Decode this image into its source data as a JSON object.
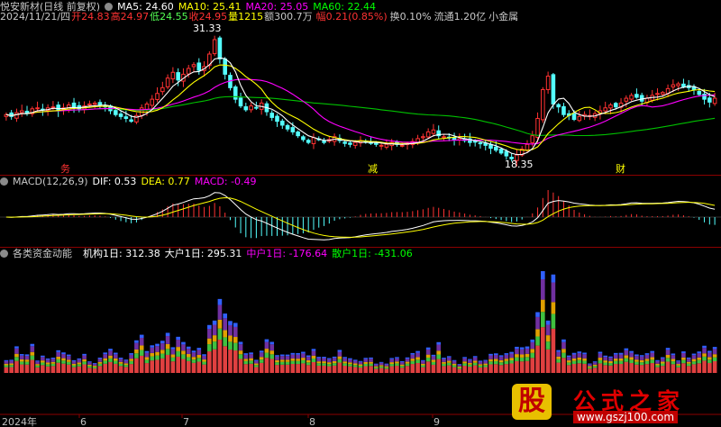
{
  "header": {
    "security": "悦安新材(日线 前复权)",
    "ma": [
      "MA5: 24.60",
      "MA10: 25.41",
      "MA20: 25.05",
      "MA60: 22.44"
    ],
    "date": "2024/11/21/四",
    "open": "开24.83",
    "high": "高24.97",
    "low": "低24.55",
    "close": "收24.95",
    "volume": "量1215",
    "amount": "额300.7万",
    "change": "幅0.21(0.85%)",
    "turnover": "换0.10%",
    "float_cap": "流通1.20亿",
    "tag": "小金属"
  },
  "macd": {
    "label": "MACD(12,26,9)",
    "dif": "DIF: 0.53",
    "dea": "DEA: 0.77",
    "macd": "MACD: -0.49"
  },
  "flow": {
    "label": "各类资金动能",
    "jigou": "机构1日: 312.38",
    "dahu": "大户1日: 295.31",
    "zhonghu": "中户1日: -176.64",
    "sanhu": "散户1日: -431.06"
  },
  "price_labels": {
    "high": "31.33",
    "low": "18.35"
  },
  "event_marks": [
    "务",
    "减",
    "财"
  ],
  "x_axis": {
    "year": "2024年",
    "months": [
      "6",
      "7",
      "8",
      "9"
    ]
  },
  "colors": {
    "up": "#ff3232",
    "down": "#54ffff",
    "ma5": "#ffffff",
    "ma10": "#ffff00",
    "ma20": "#ff00ff",
    "ma60": "#00c000",
    "flow_jigou": "#7030a0",
    "flow_dahu": "#e04040",
    "flow_zhonghu": "#40c040",
    "flow_sanhu": "#e0a000"
  },
  "watermark": {
    "big": "股",
    "title": "公式之家",
    "url": "www.gszj100.com"
  },
  "chart_data": [
    {
      "type": "candlestick",
      "title": "悦安新材(日线 前复权)",
      "ylim": [
        17.5,
        32.5
      ],
      "series_close": [
        23.2,
        23.0,
        23.4,
        23.6,
        23.3,
        23.8,
        23.9,
        23.7,
        23.9,
        24.0,
        23.6,
        23.9,
        24.2,
        24.0,
        23.8,
        24.1,
        24.3,
        24.4,
        24.2,
        24.0,
        23.6,
        23.2,
        23.0,
        22.8,
        22.5,
        23.1,
        23.9,
        24.3,
        24.8,
        25.4,
        26.0,
        27.0,
        27.6,
        26.8,
        27.4,
        28.0,
        28.4,
        27.8,
        28.2,
        29.5,
        31.0,
        29.0,
        27.4,
        26.0,
        24.8,
        24.1,
        23.7,
        24.1,
        23.9,
        24.4,
        23.5,
        22.9,
        22.5,
        22.1,
        21.7,
        21.4,
        21.0,
        20.6,
        20.3,
        20.8,
        20.6,
        20.3,
        20.6,
        20.9,
        20.5,
        20.2,
        20.1,
        20.3,
        20.5,
        20.4,
        20.2,
        20.1,
        20.0,
        20.1,
        20.3,
        20.1,
        20.0,
        20.2,
        20.4,
        20.7,
        20.9,
        21.4,
        21.6,
        21.0,
        20.9,
        20.8,
        20.6,
        20.7,
        20.5,
        20.3,
        20.4,
        20.2,
        20.0,
        19.7,
        19.5,
        19.2,
        18.9,
        18.6,
        19.0,
        19.6,
        20.1,
        21.0,
        22.8,
        25.8,
        27.2,
        24.3,
        24.0,
        23.2,
        23.1,
        22.7,
        23.0,
        23.2,
        23.1,
        23.3,
        23.6,
        23.9,
        24.2,
        24.0,
        24.4,
        24.9,
        25.2,
        25.0,
        24.6,
        24.9,
        25.2,
        25.4,
        25.5,
        25.9,
        26.3,
        26.4,
        26.1,
        26.0,
        25.8,
        25.3,
        24.8,
        24.5,
        24.9
      ],
      "ma5_last": 24.6,
      "ma10_last": 25.41,
      "ma20_last": 25.05,
      "ma60_last": 22.44,
      "annotations": [
        {
          "label": "31.33",
          "note": "period high"
        },
        {
          "label": "18.35",
          "note": "period low"
        }
      ]
    },
    {
      "type": "bar",
      "title": "MACD(12,26,9)",
      "series": [
        {
          "name": "DIF",
          "last": 0.53
        },
        {
          "name": "DEA",
          "last": 0.77
        },
        {
          "name": "MACD",
          "last": -0.49
        }
      ]
    },
    {
      "type": "bar",
      "title": "各类资金动能",
      "series": [
        {
          "name": "机构1日",
          "last": 312.38
        },
        {
          "name": "大户1日",
          "last": 295.31
        },
        {
          "name": "中户1日",
          "last": -176.64
        },
        {
          "name": "散户1日",
          "last": -431.06
        }
      ]
    }
  ]
}
